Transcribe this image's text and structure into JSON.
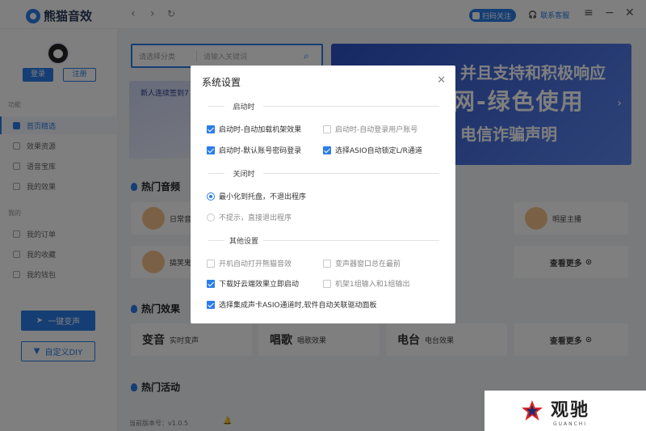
{
  "app": {
    "name": "熊猫音效"
  },
  "topbar": {
    "back_icon": "chevron-left-icon",
    "forward_icon": "chevron-right-icon",
    "refresh_icon": "refresh-icon",
    "follow_label": "扫码关注",
    "service_label": "联系客服",
    "menu_icon": "hamburger-icon",
    "minimize_icon": "minimize-icon",
    "close_icon": "close-icon"
  },
  "sidebar": {
    "login_label": "登录",
    "register_label": "注册",
    "section_function": "功能",
    "items_function": [
      {
        "label": "首页精选",
        "active": true
      },
      {
        "label": "效果资源",
        "active": false
      },
      {
        "label": "语音宝库",
        "active": false
      },
      {
        "label": "我的效果",
        "active": false
      }
    ],
    "section_mine": "我的",
    "items_mine": [
      {
        "label": "我的订单"
      },
      {
        "label": "我的收藏"
      },
      {
        "label": "我的钱包"
      }
    ],
    "onekey_label": "一键变声",
    "diy_label": "自定义DIY"
  },
  "main": {
    "search": {
      "category_placeholder": "请选择分类",
      "keyword_placeholder": "请输入关键词"
    },
    "banner_left_text": "新人连续签到7",
    "banner_right": {
      "line1": "并且支持和积极响应",
      "line2": "网-绿色使用",
      "line3": "电信诈骗声明"
    },
    "hot_audio_title": "热门音频",
    "hot_audio_cards": [
      {
        "label": "日常音"
      },
      {
        "label": "明星主播"
      },
      {
        "label": "搞笑鬼"
      }
    ],
    "see_more": "查看更多",
    "hot_effects_title": "热门效果",
    "hot_effects_cards": [
      {
        "big": "变音",
        "small": "实时变声"
      },
      {
        "big": "唱歌",
        "small": "唱歌效果"
      },
      {
        "big": "电台",
        "small": "电台效果"
      }
    ],
    "hot_activity_title": "热门活动",
    "version": "当前版本号：v1.0.5"
  },
  "dialog": {
    "title": "系统设置",
    "startup": {
      "heading": "启动时",
      "options": [
        {
          "label": "启动时-自动加载机架效果",
          "checked": true
        },
        {
          "label": "启动时-自动登录用户账号",
          "checked": false
        },
        {
          "label": "启动时-默认账号密码登录",
          "checked": true
        },
        {
          "label": "选择ASIO自动锁定L/R通道",
          "checked": true
        }
      ]
    },
    "close": {
      "heading": "关闭时",
      "options": [
        {
          "label": "最小化到托盘，不退出程序",
          "selected": true
        },
        {
          "label": "不提示，直接退出程序",
          "selected": false
        }
      ]
    },
    "other": {
      "heading": "其他设置",
      "options": [
        {
          "label": "开机自动打开熊猫音效",
          "checked": false
        },
        {
          "label": "变声器窗口总在最前",
          "checked": false
        },
        {
          "label": "下载好云端效果立即启动",
          "checked": true
        },
        {
          "label": "机架1组输入和1组输出",
          "checked": false
        },
        {
          "label": "选择集成声卡ASIO通道时,软件自动关联驱动面板",
          "checked": true
        }
      ]
    }
  },
  "watermark": {
    "cn": "观驰",
    "en": "GUANCHI"
  }
}
